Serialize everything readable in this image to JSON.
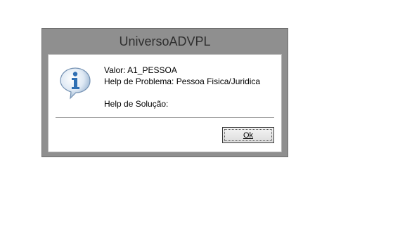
{
  "dialog": {
    "title": "UniversoADVPL",
    "icon": "info-speech-bubble-icon",
    "lines": {
      "valor": "Valor: A1_PESSOA",
      "problema": "Help de Problema: Pessoa Fisica/Juridica",
      "solucao": "Help de Solução:"
    },
    "ok_label": "Ok"
  },
  "colors": {
    "frame": "#8f8f8f",
    "client_bg": "#ffffff",
    "icon_blue": "#2f6fb3"
  }
}
